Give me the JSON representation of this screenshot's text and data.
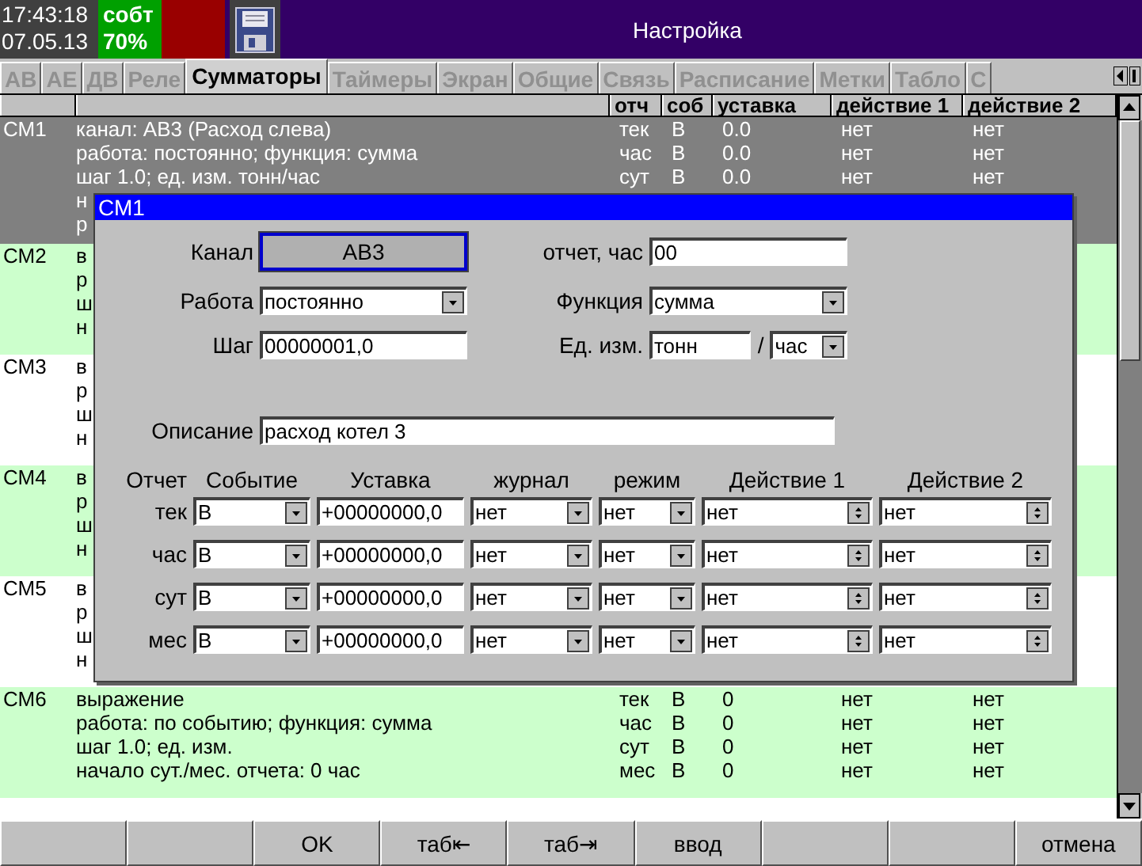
{
  "status": {
    "time": "17:43:18",
    "date": "07.05.13",
    "mode": "собт",
    "charge": "70%"
  },
  "window": {
    "title": "Настройка"
  },
  "tabs": [
    {
      "label": "АВ",
      "selected": false
    },
    {
      "label": "АЕ",
      "selected": false
    },
    {
      "label": "ДВ",
      "selected": false
    },
    {
      "label": "Реле",
      "selected": false
    },
    {
      "label": "Сумматоры",
      "selected": true
    },
    {
      "label": "Таймеры",
      "selected": false
    },
    {
      "label": "Экран",
      "selected": false
    },
    {
      "label": "Общие",
      "selected": false
    },
    {
      "label": "Связь",
      "selected": false
    },
    {
      "label": "Расписание",
      "selected": false
    },
    {
      "label": "Метки",
      "selected": false
    },
    {
      "label": "Табло",
      "selected": false
    },
    {
      "label": "С",
      "selected": false
    }
  ],
  "table": {
    "columns": [
      "отч",
      "соб",
      "уставка",
      "действие 1",
      "действие 2"
    ],
    "rows": [
      {
        "id": "СМ1",
        "selected": true,
        "tinted": false,
        "lines": [
          "канал: АВ3 (Расход слева)",
          "работа: постоянно; функция: сумма",
          "шаг 1.0; ед. изм. тонн/час",
          "н",
          "р"
        ],
        "reports": [
          [
            "тек",
            "В",
            "0.0",
            "нет",
            "нет"
          ],
          [
            "час",
            "В",
            "0.0",
            "нет",
            "нет"
          ],
          [
            "сут",
            "В",
            "0.0",
            "нет",
            "нет"
          ]
        ]
      },
      {
        "id": "СМ2",
        "selected": false,
        "tinted": true,
        "lines": [
          "в",
          "р",
          "ш",
          "н"
        ]
      },
      {
        "id": "СМ3",
        "selected": false,
        "tinted": false,
        "lines": [
          "в",
          "р",
          "ш",
          "н"
        ]
      },
      {
        "id": "СМ4",
        "selected": false,
        "tinted": true,
        "lines": [
          "в",
          "р",
          "ш",
          "н"
        ]
      },
      {
        "id": "СМ5",
        "selected": false,
        "tinted": false,
        "lines": [
          "в",
          "р",
          "ш",
          "н"
        ]
      },
      {
        "id": "СМ6",
        "selected": false,
        "tinted": true,
        "lines": [
          "выражение",
          "работа: по событию; функция: сумма",
          "шаг 1.0; ед. изм.",
          "начало сут./мес. отчета: 0 час"
        ],
        "reports": [
          [
            "тек",
            "В",
            "0",
            "нет",
            "нет"
          ],
          [
            "час",
            "В",
            "0",
            "нет",
            "нет"
          ],
          [
            "сут",
            "В",
            "0",
            "нет",
            "нет"
          ],
          [
            "мес",
            "В",
            "0",
            "нет",
            "нет"
          ]
        ]
      }
    ]
  },
  "dialog": {
    "title": "СМ1",
    "channel": {
      "label": "Канал",
      "value": "АВ3"
    },
    "report_hour": {
      "label": "отчет, час",
      "value": "00"
    },
    "work": {
      "label": "Работа",
      "value": "постоянно"
    },
    "function": {
      "label": "Функция",
      "value": "сумма"
    },
    "step": {
      "label": "Шаг",
      "value": "00000001,0"
    },
    "unit": {
      "label": "Ед. изм.",
      "value": "тонн",
      "separator": "/",
      "per": "час"
    },
    "description": {
      "label": "Описание",
      "value": "расход котел 3"
    },
    "grid": {
      "columns": [
        "Отчет",
        "Событие",
        "Уставка",
        "журнал",
        "режим",
        "Действие 1",
        "Действие 2"
      ],
      "rows": [
        {
          "report": "тек",
          "event": "В",
          "setpoint": "+00000000,0",
          "journal": "нет",
          "mode": "нет",
          "action_1": "нет",
          "action_2": "нет"
        },
        {
          "report": "час",
          "event": "В",
          "setpoint": "+00000000,0",
          "journal": "нет",
          "mode": "нет",
          "action_1": "нет",
          "action_2": "нет"
        },
        {
          "report": "сут",
          "event": "В",
          "setpoint": "+00000000,0",
          "journal": "нет",
          "mode": "нет",
          "action_1": "нет",
          "action_2": "нет"
        },
        {
          "report": "мес",
          "event": "В",
          "setpoint": "+00000000,0",
          "journal": "нет",
          "mode": "нет",
          "action_1": "нет",
          "action_2": "нет"
        }
      ]
    }
  },
  "footer": [
    {
      "kind": "blank"
    },
    {
      "kind": "blank"
    },
    {
      "kind": "button",
      "label": "OK"
    },
    {
      "kind": "button",
      "label": "таб⇤"
    },
    {
      "kind": "button",
      "label": "таб⇥"
    },
    {
      "kind": "button",
      "label": "ввод"
    },
    {
      "kind": "blank"
    },
    {
      "kind": "blank"
    },
    {
      "kind": "button",
      "label": "отмена"
    }
  ]
}
